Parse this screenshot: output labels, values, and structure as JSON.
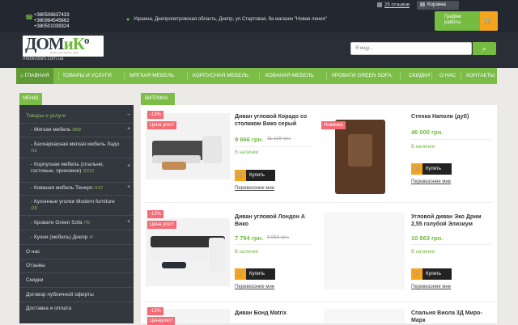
{
  "topbar": {
    "phones": [
      "+380506637433",
      "+380984545662",
      "+380501039324"
    ],
    "address": "Украина, Днепропетровская область, Днепр, ул.Стартовая, 9а магазин \"Новая линия\"",
    "reviews": "25 отзывов",
    "cart": "Корзина",
    "schedule_line1": "График",
    "schedule_line2": "работы"
  },
  "header": {
    "logo_text_a": "ДОМ",
    "logo_text_b": "иК",
    "logo_text_c": "о",
    "logo_sub": "мебель для вашего дома",
    "site_url": "meblivdom.com.ua",
    "search_placeholder": "Я ищу..."
  },
  "nav": {
    "items": [
      "ГЛАВНАЯ",
      "ТОВАРЫ И УСЛУГИ",
      "МЯГКАЯ МЕБЕЛЬ",
      "КОРПУСНАЯ МЕБЕЛЬ",
      "КОВАНАЯ МЕБЕЛЬ",
      "КРОВАТИ GREEN SOFA",
      "СКИДКИ",
      "О НАС",
      "КОНТАКТЫ"
    ]
  },
  "sidebar": {
    "tab": "МЕНЮ",
    "items": [
      {
        "label": "Товары и услуги",
        "count": ""
      },
      {
        "label": "Мягкая мебель",
        "count": "/809"
      },
      {
        "label": "Бескаркасная мягкая мебель Ладо",
        "count": "/16"
      },
      {
        "label": "Корпусная мебель (спальни, гостиные, прихожие)",
        "count": "/2212"
      },
      {
        "label": "Кованая мебель Тенеро",
        "count": "/137"
      },
      {
        "label": "Кухонные уголки Modern furniture",
        "count": "/28"
      },
      {
        "label": "Кровати Green Sofa",
        "count": "/70"
      },
      {
        "label": "Кухни (мебель) Днепр",
        "count": "/4"
      },
      {
        "label": "О нас",
        "count": ""
      },
      {
        "label": "Отзывы",
        "count": ""
      },
      {
        "label": "Скидки",
        "count": ""
      },
      {
        "label": "Договор публичной оферты",
        "count": ""
      },
      {
        "label": "Доставка и оплата",
        "count": ""
      }
    ]
  },
  "showcase": {
    "tab": "ВИТРИНА",
    "buy": "Купить",
    "compare": "Перевезоние мне",
    "in_stock": "В наличии",
    "products": [
      {
        "title": "Диван угловой Корадо со столиком Вико серый",
        "price": "9 666 грн.",
        "old": "11 116 грн.",
        "discount": "-13%",
        "label": "Цена упет!"
      },
      {
        "title": "Стенка Наполи (дуб)",
        "price": "46 000 грн.",
        "old": "",
        "discount": "",
        "label": "Новинка"
      },
      {
        "title": "Диван угловой Лондон А Вико",
        "price": "7 794 грн.",
        "old": "8 963 грн.",
        "discount": "-13%",
        "label": "Цена упет!"
      },
      {
        "title": "Угловой диван Эко Дрим 2,55 голубой Элизиум",
        "price": "10 863 грн.",
        "old": "",
        "discount": "",
        "label": ""
      },
      {
        "title": "Диван Бонд Matrix",
        "price": "",
        "old": "",
        "discount": "-13%",
        "label": "Ценаупет!"
      },
      {
        "title": "Спальня Виола 3Д Миро-Марк",
        "price": "",
        "old": "",
        "discount": "",
        "label": ""
      }
    ]
  }
}
